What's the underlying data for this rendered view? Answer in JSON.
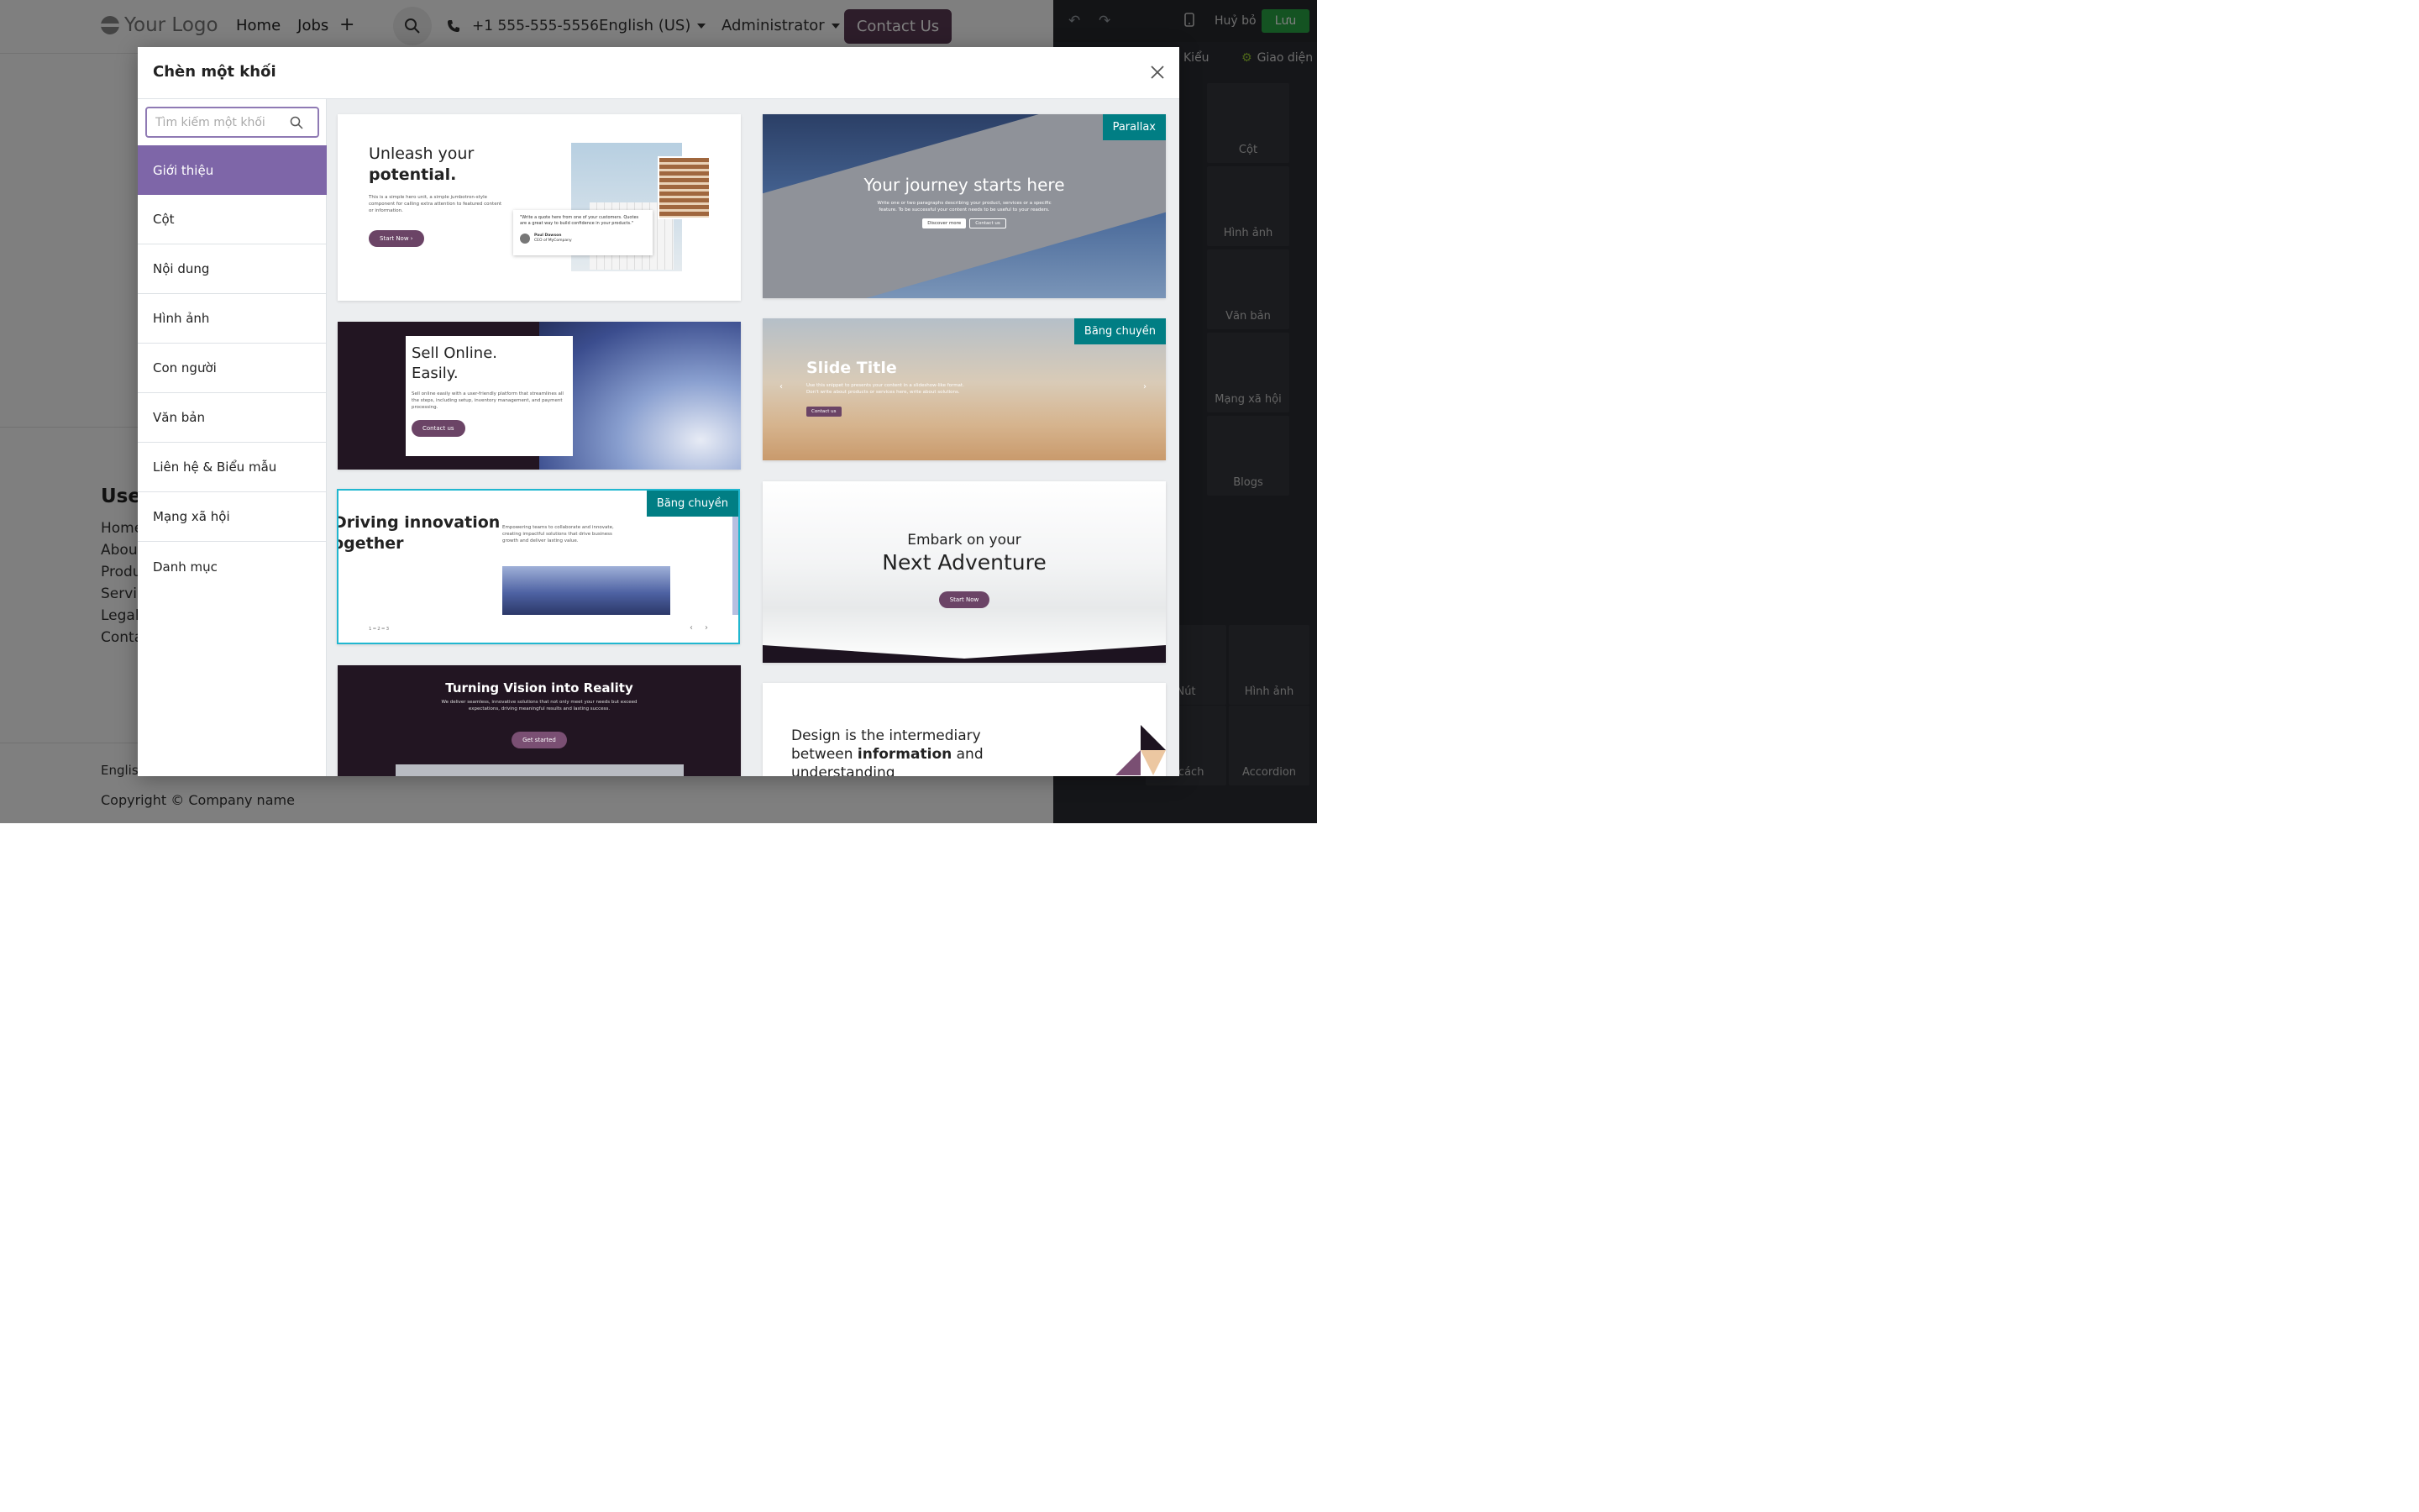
{
  "site": {
    "logo": "Your Logo",
    "nav": [
      "Home",
      "Jobs"
    ],
    "phone": "+1 555-555-5556",
    "language": "English (US)",
    "admin": "Administrator",
    "contact": "Contact Us",
    "useful_title": "Usef",
    "useful_links": [
      "Home",
      "Abou",
      "Produ",
      "Servi",
      "Legal",
      "Conta"
    ],
    "footer_lang": "Englis",
    "copyright": "Copyright © Company name"
  },
  "editor": {
    "cancel": "Huỷ bỏ",
    "save": "Lưu",
    "tab_style": "Kiểu",
    "tab_theme": "Giao diện",
    "tiles": [
      "Cột",
      "Hình ảnh",
      "Văn bản",
      "Mạng xã hội",
      "Blogs",
      "Nút",
      "Hình ảnh",
      "n cách",
      "Accordion"
    ]
  },
  "modal": {
    "title": "Chèn một khối",
    "search_placeholder": "Tìm kiếm một khối",
    "categories": [
      "Giới thiệu",
      "Cột",
      "Nội dung",
      "Hình ảnh",
      "Con người",
      "Văn bản",
      "Liên hệ & Biểu mẫu",
      "Mạng xã hội",
      "Danh mục"
    ],
    "active_category": "Giới thiệu"
  },
  "cards": {
    "c1": {
      "title1": "Unleash your",
      "title2": "potential.",
      "body": "This is a simple hero unit, a simple jumbotron-style component for calling extra attention to featured content or information.",
      "button": "Start Now",
      "quote": "\"Write a quote here from one of your customers. Quotes are a great way to build confidence in your products.\"",
      "author": "Paul Dawson",
      "role": "CEO of MyCompany"
    },
    "c2": {
      "badge": "Parallax",
      "title": "Your journey starts here",
      "body": "Write one or two paragraphs describing your product, services or a specific feature. To be successful your content needs to be useful to your readers.",
      "btn1": "Discover more",
      "btn2": "Contact us"
    },
    "c3": {
      "title1": "Sell Online.",
      "title2": "Easily.",
      "body": "Sell online easily with a user-friendly platform that streamlines all the steps, including setup, inventory management, and payment processing.",
      "button": "Contact us"
    },
    "c4": {
      "badge": "Băng chuyền",
      "title": "Slide Title",
      "body": "Use this snippet to presents your content in a slideshow-like format. Don't write about products or services here, write about solutions.",
      "button": "Contact us"
    },
    "c5": {
      "badge": "Băng chuyền",
      "title1": "Driving innovation",
      "title2": "together",
      "body": "Empowering teams to collaborate and innovate, creating impactful solutions that drive business growth and deliver lasting value.",
      "pager": "1 ━  2 ━   3"
    },
    "c6": {
      "title1": "Embark on your",
      "title2": "Next Adventure",
      "button": "Start Now"
    },
    "c7": {
      "title": "Turning Vision into Reality",
      "body": "We deliver seamless, innovative solutions that not only meet your needs but exceed expectations, driving meaningful results and lasting success.",
      "button": "Get started"
    },
    "c8": {
      "line1": "Design is the intermediary",
      "line2_a": "between ",
      "line2_b": "information",
      "line2_c": " and",
      "line3": "understanding"
    }
  },
  "colors": {
    "accent": "#7e66a8",
    "badge": "#017e84",
    "brand_button": "#5a3a55",
    "save": "#28a745"
  }
}
